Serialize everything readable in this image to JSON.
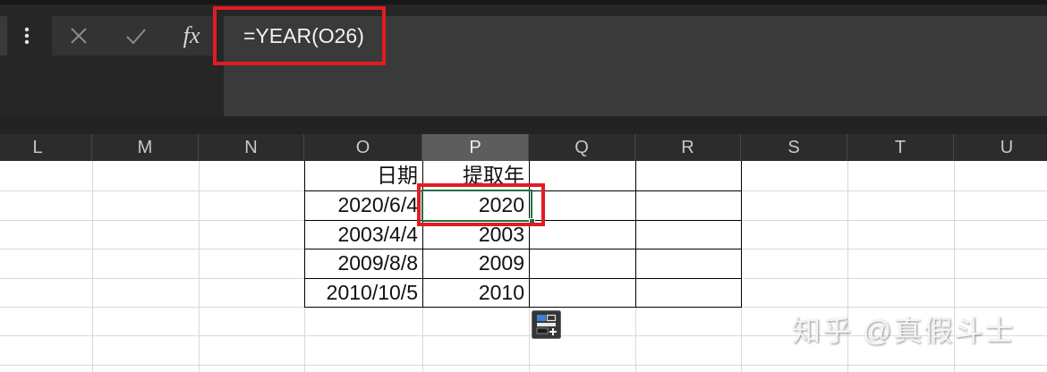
{
  "formula_bar": {
    "more_icon": "more-vertical-icon",
    "cancel_icon": "close-icon",
    "enter_icon": "check-icon",
    "fx_label": "fx",
    "formula": "=YEAR(O26)"
  },
  "columns": [
    {
      "label": "L"
    },
    {
      "label": "M"
    },
    {
      "label": "N"
    },
    {
      "label": "O"
    },
    {
      "label": "P",
      "selected": true
    },
    {
      "label": "Q"
    },
    {
      "label": "R"
    },
    {
      "label": "S"
    },
    {
      "label": "T"
    },
    {
      "label": "U"
    }
  ],
  "table": {
    "headers": [
      "日期",
      "提取年"
    ],
    "rows": [
      [
        "2020/6/4",
        "2020"
      ],
      [
        "2003/4/4",
        "2003"
      ],
      [
        "2009/8/8",
        "2009"
      ],
      [
        "2010/10/5",
        "2010"
      ]
    ]
  },
  "quick_analysis_icon": "quick-analysis-icon",
  "watermark": "知乎 @真假斗士",
  "colors": {
    "background": "#262626",
    "formula_input": "#3a3a3a",
    "button_group": "#333333",
    "band": "#232323",
    "header_bg": "#2c2c2c",
    "header_selected": "#5d5d5d",
    "header_text": "#c8c8c8",
    "header_divider": "#474747",
    "grid_bg": "#ffffff",
    "grid_line": "#d9d9d9",
    "table_border": "#000000",
    "cell_text": "#111111",
    "selection": "#1e7145",
    "annotation": "#e31b23",
    "icon_muted": "#8a8a8a",
    "icon_light": "#e6e6e6",
    "formula_text": "#f2f2f2",
    "watermark": "#f5f5f5"
  }
}
